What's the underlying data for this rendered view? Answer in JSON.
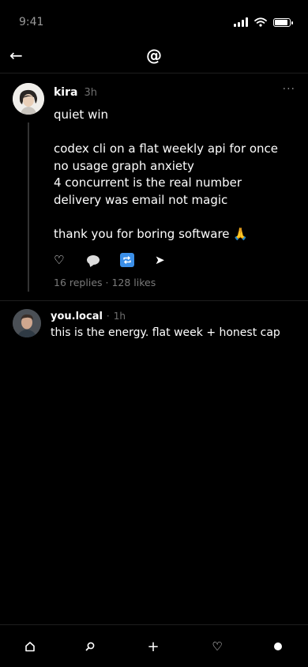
{
  "status_bar": {
    "time": "9:41"
  },
  "header": {
    "logo": "@",
    "back_icon": "←"
  },
  "post": {
    "username": "kira",
    "timestamp": "3h",
    "more_icon": "···",
    "lines": [
      "quiet win",
      "",
      "codex cli on a flat weekly api for once",
      "no usage graph anxiety",
      "4 concurrent is the real number",
      "delivery was email not magic",
      "",
      "thank you for boring software 🙏"
    ],
    "actions": {
      "like_icon": "♡",
      "share_icon": "➤"
    },
    "stats": "16 replies · 128 likes"
  },
  "reply": {
    "username": "you.local",
    "separator": "·",
    "timestamp": "1h",
    "text": "this is the energy. flat week + honest cap"
  },
  "bottom_nav": {
    "compose_icon": "+",
    "activity_icon": "♡"
  },
  "colors": {
    "background": "#000000",
    "text": "#ffffff",
    "muted": "#7a7a7a",
    "divider": "#1e1e1e",
    "repost_accent": "#3b8fe8"
  }
}
